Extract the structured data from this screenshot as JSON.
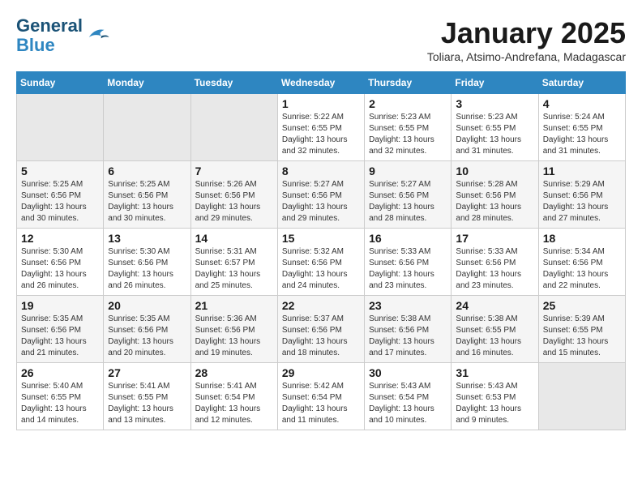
{
  "header": {
    "logo_line1": "General",
    "logo_line2": "Blue",
    "month": "January 2025",
    "location": "Toliara, Atsimo-Andrefana, Madagascar"
  },
  "days_of_week": [
    "Sunday",
    "Monday",
    "Tuesday",
    "Wednesday",
    "Thursday",
    "Friday",
    "Saturday"
  ],
  "weeks": [
    [
      {
        "day": "",
        "info": ""
      },
      {
        "day": "",
        "info": ""
      },
      {
        "day": "",
        "info": ""
      },
      {
        "day": "1",
        "info": "Sunrise: 5:22 AM\nSunset: 6:55 PM\nDaylight: 13 hours\nand 32 minutes."
      },
      {
        "day": "2",
        "info": "Sunrise: 5:23 AM\nSunset: 6:55 PM\nDaylight: 13 hours\nand 32 minutes."
      },
      {
        "day": "3",
        "info": "Sunrise: 5:23 AM\nSunset: 6:55 PM\nDaylight: 13 hours\nand 31 minutes."
      },
      {
        "day": "4",
        "info": "Sunrise: 5:24 AM\nSunset: 6:55 PM\nDaylight: 13 hours\nand 31 minutes."
      }
    ],
    [
      {
        "day": "5",
        "info": "Sunrise: 5:25 AM\nSunset: 6:56 PM\nDaylight: 13 hours\nand 30 minutes."
      },
      {
        "day": "6",
        "info": "Sunrise: 5:25 AM\nSunset: 6:56 PM\nDaylight: 13 hours\nand 30 minutes."
      },
      {
        "day": "7",
        "info": "Sunrise: 5:26 AM\nSunset: 6:56 PM\nDaylight: 13 hours\nand 29 minutes."
      },
      {
        "day": "8",
        "info": "Sunrise: 5:27 AM\nSunset: 6:56 PM\nDaylight: 13 hours\nand 29 minutes."
      },
      {
        "day": "9",
        "info": "Sunrise: 5:27 AM\nSunset: 6:56 PM\nDaylight: 13 hours\nand 28 minutes."
      },
      {
        "day": "10",
        "info": "Sunrise: 5:28 AM\nSunset: 6:56 PM\nDaylight: 13 hours\nand 28 minutes."
      },
      {
        "day": "11",
        "info": "Sunrise: 5:29 AM\nSunset: 6:56 PM\nDaylight: 13 hours\nand 27 minutes."
      }
    ],
    [
      {
        "day": "12",
        "info": "Sunrise: 5:30 AM\nSunset: 6:56 PM\nDaylight: 13 hours\nand 26 minutes."
      },
      {
        "day": "13",
        "info": "Sunrise: 5:30 AM\nSunset: 6:56 PM\nDaylight: 13 hours\nand 26 minutes."
      },
      {
        "day": "14",
        "info": "Sunrise: 5:31 AM\nSunset: 6:57 PM\nDaylight: 13 hours\nand 25 minutes."
      },
      {
        "day": "15",
        "info": "Sunrise: 5:32 AM\nSunset: 6:56 PM\nDaylight: 13 hours\nand 24 minutes."
      },
      {
        "day": "16",
        "info": "Sunrise: 5:33 AM\nSunset: 6:56 PM\nDaylight: 13 hours\nand 23 minutes."
      },
      {
        "day": "17",
        "info": "Sunrise: 5:33 AM\nSunset: 6:56 PM\nDaylight: 13 hours\nand 23 minutes."
      },
      {
        "day": "18",
        "info": "Sunrise: 5:34 AM\nSunset: 6:56 PM\nDaylight: 13 hours\nand 22 minutes."
      }
    ],
    [
      {
        "day": "19",
        "info": "Sunrise: 5:35 AM\nSunset: 6:56 PM\nDaylight: 13 hours\nand 21 minutes."
      },
      {
        "day": "20",
        "info": "Sunrise: 5:35 AM\nSunset: 6:56 PM\nDaylight: 13 hours\nand 20 minutes."
      },
      {
        "day": "21",
        "info": "Sunrise: 5:36 AM\nSunset: 6:56 PM\nDaylight: 13 hours\nand 19 minutes."
      },
      {
        "day": "22",
        "info": "Sunrise: 5:37 AM\nSunset: 6:56 PM\nDaylight: 13 hours\nand 18 minutes."
      },
      {
        "day": "23",
        "info": "Sunrise: 5:38 AM\nSunset: 6:56 PM\nDaylight: 13 hours\nand 17 minutes."
      },
      {
        "day": "24",
        "info": "Sunrise: 5:38 AM\nSunset: 6:55 PM\nDaylight: 13 hours\nand 16 minutes."
      },
      {
        "day": "25",
        "info": "Sunrise: 5:39 AM\nSunset: 6:55 PM\nDaylight: 13 hours\nand 15 minutes."
      }
    ],
    [
      {
        "day": "26",
        "info": "Sunrise: 5:40 AM\nSunset: 6:55 PM\nDaylight: 13 hours\nand 14 minutes."
      },
      {
        "day": "27",
        "info": "Sunrise: 5:41 AM\nSunset: 6:55 PM\nDaylight: 13 hours\nand 13 minutes."
      },
      {
        "day": "28",
        "info": "Sunrise: 5:41 AM\nSunset: 6:54 PM\nDaylight: 13 hours\nand 12 minutes."
      },
      {
        "day": "29",
        "info": "Sunrise: 5:42 AM\nSunset: 6:54 PM\nDaylight: 13 hours\nand 11 minutes."
      },
      {
        "day": "30",
        "info": "Sunrise: 5:43 AM\nSunset: 6:54 PM\nDaylight: 13 hours\nand 10 minutes."
      },
      {
        "day": "31",
        "info": "Sunrise: 5:43 AM\nSunset: 6:53 PM\nDaylight: 13 hours\nand 9 minutes."
      },
      {
        "day": "",
        "info": ""
      }
    ]
  ]
}
